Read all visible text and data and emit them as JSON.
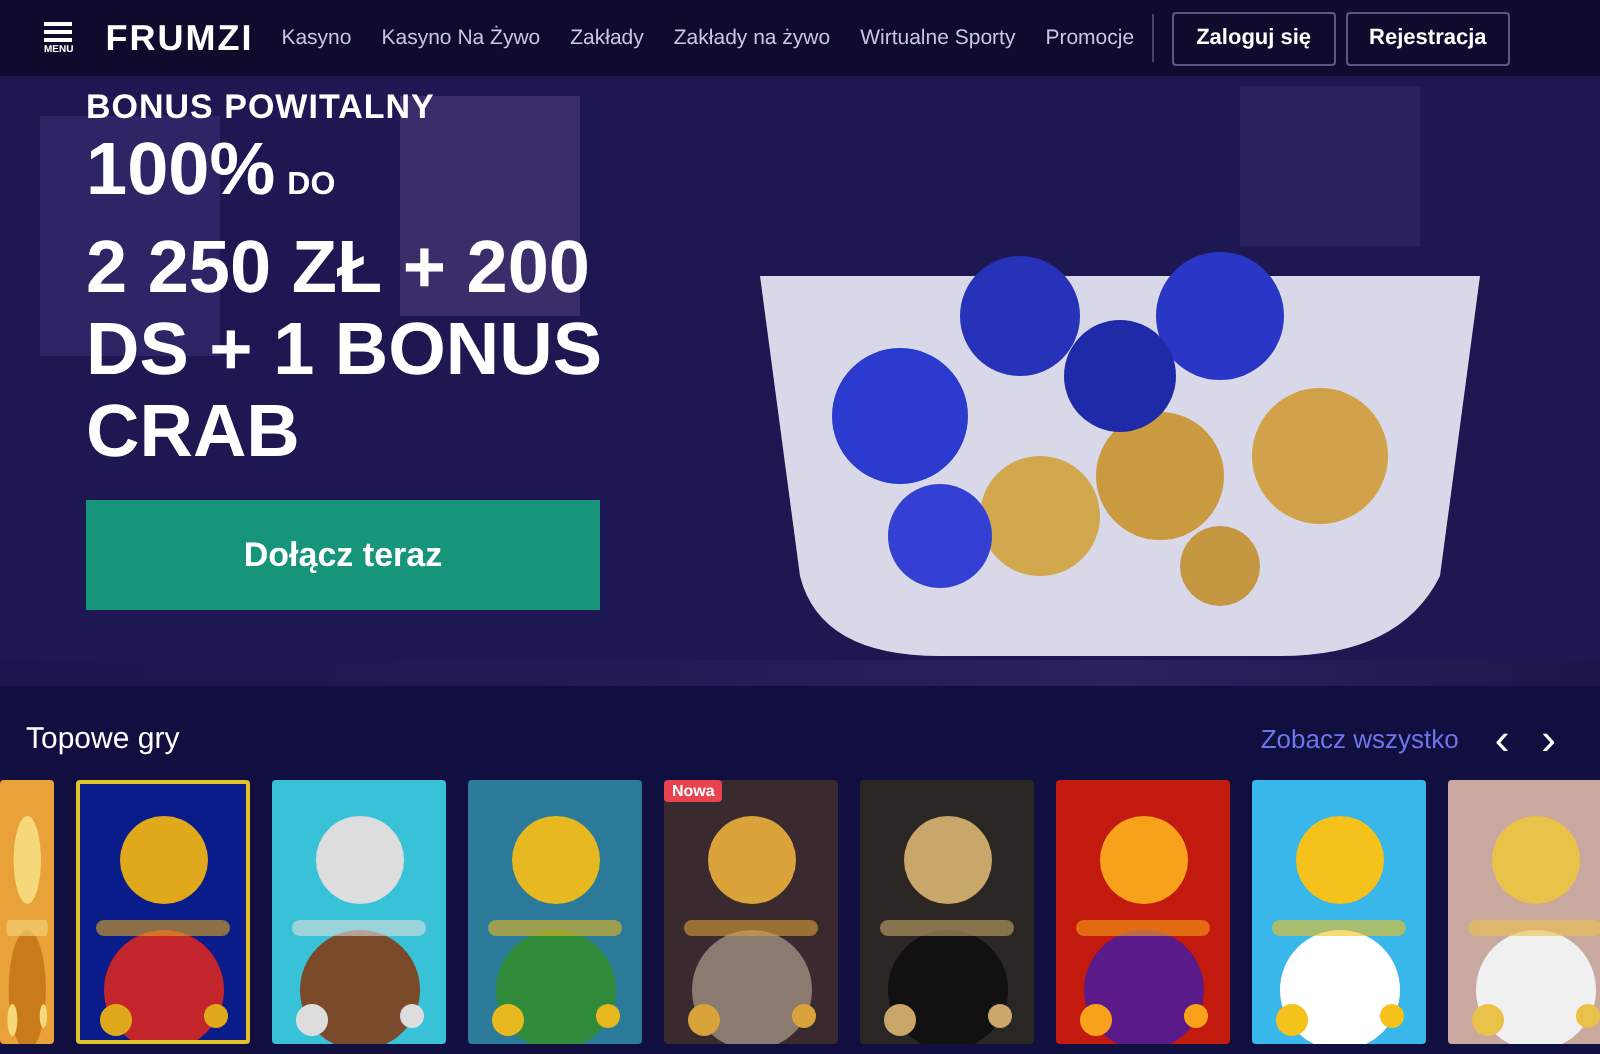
{
  "header": {
    "menu_label": "MENU",
    "logo": "FRUMZI",
    "nav": [
      {
        "label": "Kasyno"
      },
      {
        "label": "Kasyno Na Żywo"
      },
      {
        "label": "Zakłady"
      },
      {
        "label": "Zakłady na żywo"
      },
      {
        "label": "Wirtualne Sporty"
      },
      {
        "label": "Promocje"
      }
    ],
    "buttons": [
      "Zaloguj się",
      "Rejestracja"
    ]
  },
  "hero": {
    "eyebrow": "BONUS POWITALNY",
    "amount": "100%",
    "amount_suffix": "DO",
    "lines": [
      "2 250 ZŁ + 200",
      "DS + 1 BONUS",
      "CRAB"
    ],
    "cta": "Dołącz teraz",
    "kind": "picture"
  },
  "section": {
    "title": "Topowe gry",
    "see_all": "Zobacz wszystko",
    "prev": "‹",
    "next": "›"
  },
  "games": [
    {
      "kind": "picture",
      "selected": false
    },
    {
      "kind": "picture",
      "selected": true
    },
    {
      "kind": "picture",
      "selected": false
    },
    {
      "kind": "picture",
      "selected": false
    },
    {
      "kind": "picture",
      "selected": false,
      "badge": "Nowa"
    },
    {
      "kind": "picture",
      "selected": false
    },
    {
      "kind": "picture",
      "selected": false
    },
    {
      "kind": "picture",
      "selected": false
    },
    {
      "kind": "picture",
      "selected": false
    }
  ]
}
